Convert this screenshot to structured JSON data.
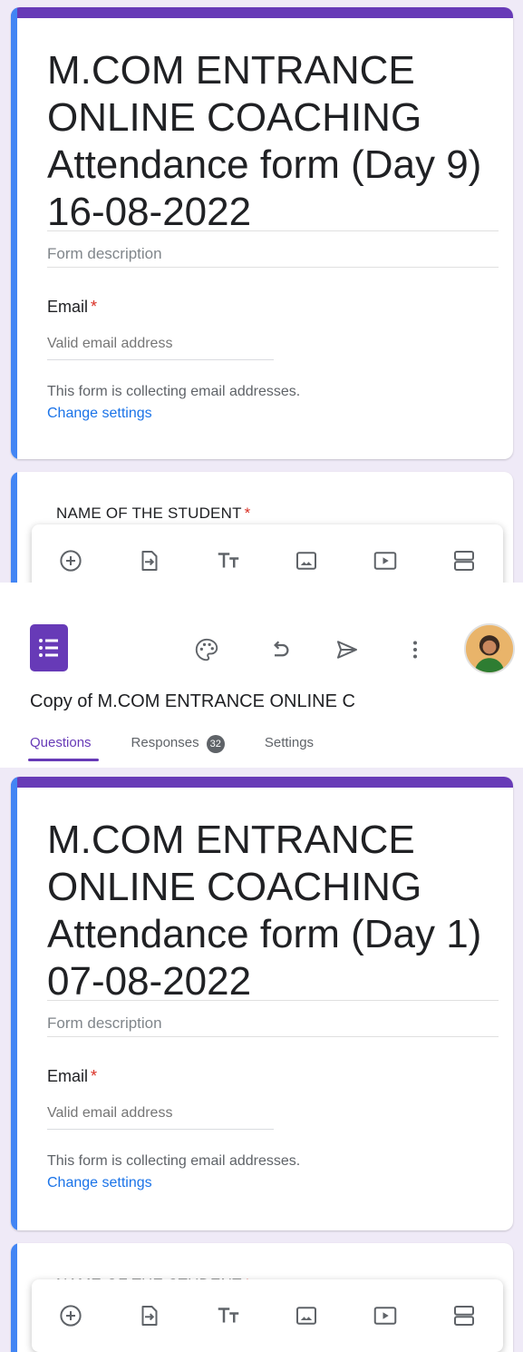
{
  "top": {
    "form_title": "M.COM ENTRANCE ONLINE COACHING Attendance  form (Day 9) 16-08-2022",
    "form_description": "Form description",
    "email_label": "Email",
    "required_mark": "*",
    "email_placeholder": "Valid email address",
    "collect_note": "This form is collecting email addresses.",
    "change_settings": "Change settings",
    "question_label": "NAME OF THE STUDENT",
    "question_required": "*"
  },
  "header": {
    "doc_title": "Copy of M.COM ENTRANCE ONLINE C",
    "tabs": [
      {
        "label": "Questions"
      },
      {
        "label": "Responses",
        "badge": "32"
      },
      {
        "label": "Settings"
      }
    ],
    "icons": [
      "palette-icon",
      "undo-icon",
      "send-icon",
      "more-vert-icon"
    ]
  },
  "bottom": {
    "form_title": "M.COM ENTRANCE ONLINE COACHING Attendance  form (Day 1) 07-08-2022",
    "form_description": "Form description",
    "email_label": "Email",
    "required_mark": "*",
    "email_placeholder": "Valid email address",
    "collect_note": "This form is collecting email addresses.",
    "change_settings": "Change settings",
    "question_label": "NAME OF THE STUDENT",
    "question_required": "*"
  },
  "toolbar": {
    "icons": [
      "add-question-icon",
      "import-questions-icon",
      "add-title-icon",
      "add-image-icon",
      "add-video-icon",
      "add-section-icon"
    ]
  },
  "colors": {
    "accent_purple": "#673ab7",
    "accent_blue": "#4285f4",
    "link_blue": "#1a73e8",
    "required_red": "#d93025",
    "page_background": "#efeaf7"
  }
}
